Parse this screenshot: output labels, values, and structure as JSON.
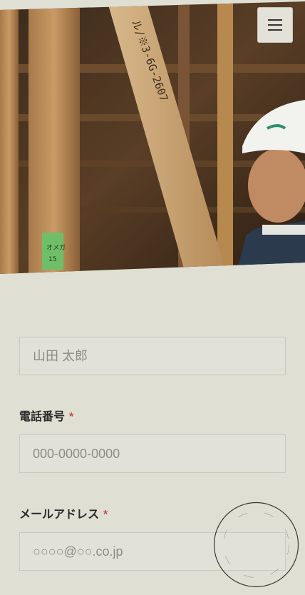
{
  "header": {
    "menu_icon": "hamburger-icon",
    "hero_photo": "construction-worker-photo"
  },
  "form": {
    "name": {
      "placeholder": "山田 太郎"
    },
    "phone": {
      "label": "電話番号",
      "required_mark": "*",
      "placeholder": "000-0000-0000"
    },
    "email": {
      "label": "メールアドレス",
      "required_mark": "*",
      "placeholder": "○○○○@○○.co.jp"
    }
  },
  "colors": {
    "background": "#e0dfd4",
    "required": "#c44e4e",
    "field_border": "#c9c8bd"
  }
}
